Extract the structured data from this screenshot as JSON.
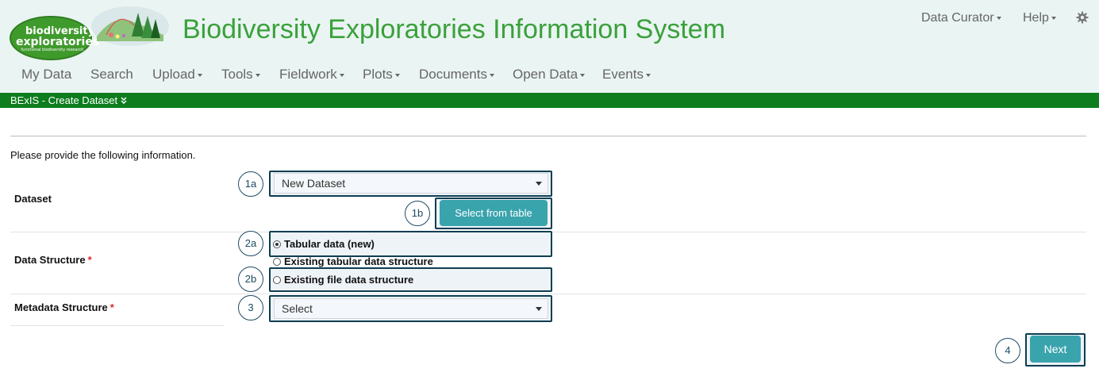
{
  "header": {
    "logo": {
      "line1": "biodiversity",
      "line2": "exploratories",
      "line3": "functional biodiversity research"
    },
    "title": "Biodiversity Exploratories Information System",
    "user_menu": "Data Curator",
    "help_menu": "Help",
    "settings_icon": "gear-icon"
  },
  "nav": {
    "items": [
      {
        "label": "My Data",
        "dropdown": false
      },
      {
        "label": "Search",
        "dropdown": false
      },
      {
        "label": "Upload",
        "dropdown": true
      },
      {
        "label": "Tools",
        "dropdown": true
      },
      {
        "label": "Fieldwork",
        "dropdown": true
      },
      {
        "label": "Plots",
        "dropdown": true
      },
      {
        "label": "Documents",
        "dropdown": true
      },
      {
        "label": "Open Data",
        "dropdown": true
      },
      {
        "label": "Events",
        "dropdown": true
      }
    ]
  },
  "breadcrumb": {
    "label": "BExIS - Create Dataset",
    "icon": "double-chevron-down-icon"
  },
  "form": {
    "intro": "Please provide the following information.",
    "dataset": {
      "label": "Dataset",
      "select_value": "New Dataset",
      "select_button": "Select from table"
    },
    "data_structure": {
      "label": "Data Structure",
      "required_mark": "*",
      "options": [
        {
          "label": "Tabular data (new)",
          "selected": true
        },
        {
          "label": "Existing tabular data structure",
          "selected": false
        },
        {
          "label": "Existing file data structure",
          "selected": false
        }
      ]
    },
    "metadata_structure": {
      "label": "Metadata Structure",
      "required_mark": "*",
      "select_value": "Select"
    },
    "next_button": "Next"
  },
  "annotations": {
    "step_1a": "1a",
    "step_1b": "1b",
    "step_2a": "2a",
    "step_2b": "2b",
    "step_3": "3",
    "step_4": "4"
  },
  "colors": {
    "header_bg": "#eaf4f3",
    "title_green": "#3aa13a",
    "breadcrumb_bar": "#0d7d1e",
    "button_teal": "#3aa4ad",
    "annotation_navy": "#0c3d52",
    "required_red": "#e0242d"
  }
}
